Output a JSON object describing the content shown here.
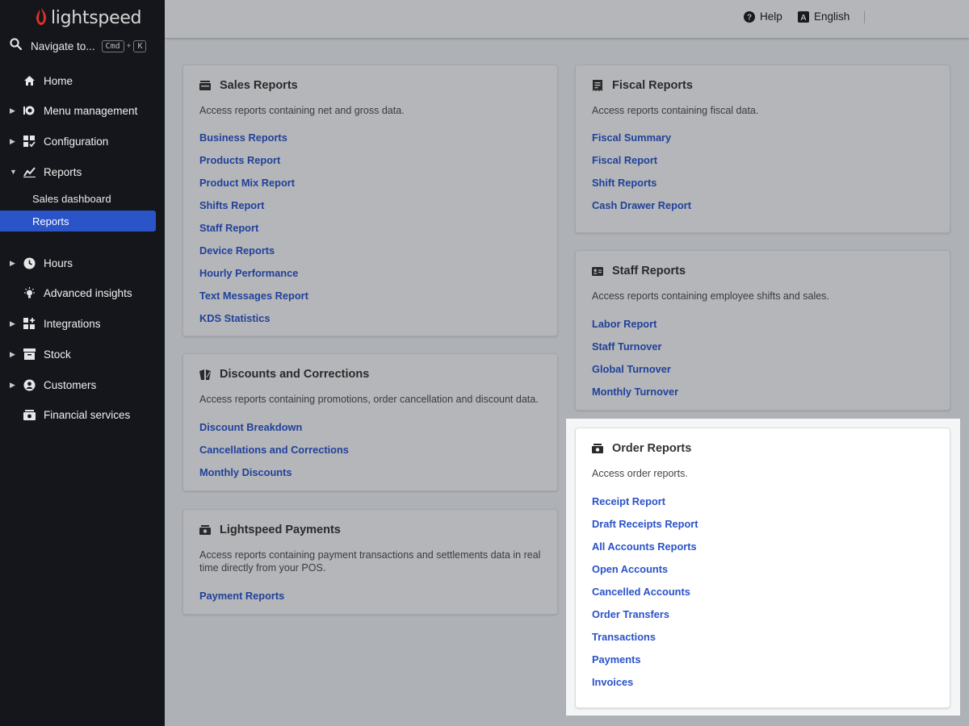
{
  "brand": {
    "name": "lightspeed"
  },
  "nav_search": {
    "label": "Navigate to...",
    "key1": "Cmd",
    "plus": "+",
    "key2": "K"
  },
  "sidebar": {
    "items": [
      {
        "label": "Home",
        "icon": "home-icon"
      },
      {
        "label": "Menu management",
        "icon": "menu-management-icon"
      },
      {
        "label": "Configuration",
        "icon": "configuration-icon"
      },
      {
        "label": "Reports",
        "icon": "reports-icon"
      },
      {
        "label": "Hours",
        "icon": "clock-icon"
      },
      {
        "label": "Advanced insights",
        "icon": "lightbulb-icon"
      },
      {
        "label": "Integrations",
        "icon": "integrations-icon"
      },
      {
        "label": "Stock",
        "icon": "stock-icon"
      },
      {
        "label": "Customers",
        "icon": "customer-icon"
      },
      {
        "label": "Financial services",
        "icon": "cash-icon"
      }
    ],
    "reports_sub": [
      {
        "label": "Sales dashboard"
      },
      {
        "label": "Reports",
        "active": true
      }
    ]
  },
  "topbar": {
    "help": "Help",
    "language": "English"
  },
  "cards": {
    "sales": {
      "title": "Sales Reports",
      "desc": "Access reports containing net and gross data.",
      "links": [
        "Business Reports",
        "Products Report",
        "Product Mix Report",
        "Shifts Report",
        "Staff Report",
        "Device Reports",
        "Hourly Performance",
        "Text Messages Report",
        "KDS Statistics"
      ]
    },
    "discounts": {
      "title": "Discounts and Corrections",
      "desc": "Access reports containing promotions, order cancellation and discount data.",
      "links": [
        "Discount Breakdown",
        "Cancellations and Corrections",
        "Monthly Discounts"
      ]
    },
    "payments": {
      "title": "Lightspeed Payments",
      "desc": "Access reports containing payment transactions and settlements data in real time directly from your POS.",
      "links": [
        "Payment Reports"
      ]
    },
    "fiscal": {
      "title": "Fiscal Reports",
      "desc": "Access reports containing fiscal data.",
      "links": [
        "Fiscal Summary",
        "Fiscal Report",
        "Shift Reports",
        "Cash Drawer Report"
      ]
    },
    "staff": {
      "title": "Staff Reports",
      "desc": "Access reports containing employee shifts and sales.",
      "links": [
        "Labor Report",
        "Staff Turnover",
        "Global Turnover",
        "Monthly Turnover"
      ]
    },
    "order": {
      "title": "Order Reports",
      "desc": "Access order reports.",
      "links": [
        "Receipt Report",
        "Draft Receipts Report",
        "All Accounts Reports",
        "Open Accounts",
        "Cancelled Accounts",
        "Order Transfers",
        "Transactions",
        "Payments",
        "Invoices"
      ]
    }
  },
  "colors": {
    "sidebar_bg": "#14161b",
    "active_item": "#2a54c8",
    "link": "#2a52c9",
    "logo_red": "#e0312c"
  }
}
